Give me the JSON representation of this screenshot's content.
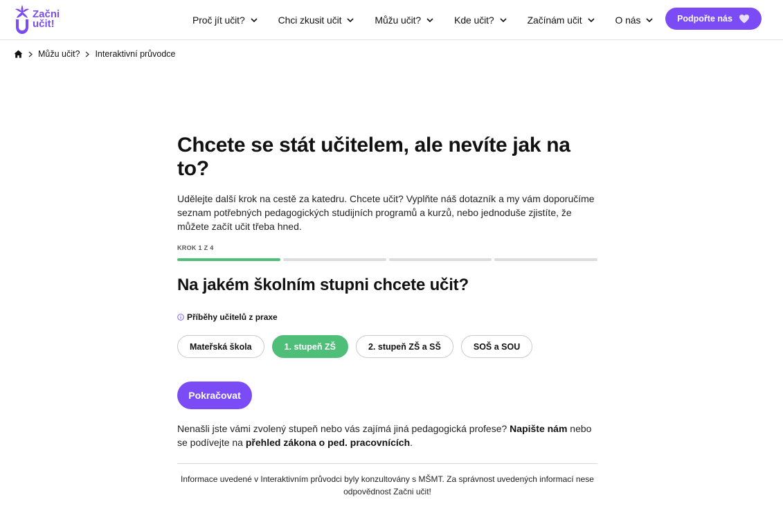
{
  "header": {
    "logo": {
      "line1": "Začni",
      "line2": "učit!",
      "color": "#7b4cf5"
    },
    "nav": [
      {
        "label": "Proč jít učit?"
      },
      {
        "label": "Chci zkusit učit"
      },
      {
        "label": "Můžu učit?"
      },
      {
        "label": "Kde učit?"
      },
      {
        "label": "Začínám učit"
      },
      {
        "label": "O nás"
      }
    ],
    "support_label": "Podpořte nás"
  },
  "breadcrumb": {
    "home_icon": "home-icon",
    "items": [
      "Můžu učit?",
      "Interaktivní průvodce"
    ]
  },
  "main": {
    "title": "Chcete se stát učitelem, ale nevíte jak na to?",
    "lead": "Udělejte další krok na cestě za katedru. Chcete učit? Vyplňte náš dotazník a my vám doporučíme seznam potřebných pedagogických studijních programů a kurzů, nebo jednoduše zjistíte, že můžete začít učit třeba hned.",
    "step_label": "KROK 1 Z 4",
    "progress": {
      "current": 1,
      "total": 4,
      "done_color": "#4fbe79",
      "todo_color": "#d9dde0"
    },
    "question": "Na jakém školním stupni chcete učit?",
    "stories_link": "Příběhy učitelů z praxe",
    "options": [
      {
        "label": "Mateřská škola",
        "selected": false
      },
      {
        "label": "1. stupeň ZŠ",
        "selected": true
      },
      {
        "label": "2. stupeň ZŠ a SŠ",
        "selected": false
      },
      {
        "label": "SOŠ a SOU",
        "selected": false
      }
    ],
    "continue_label": "Pokračovat",
    "note": {
      "part1": "Nenašli jste vámi zvolený stupeň nebo vás zajímá jiná pedagogická profese? ",
      "link1": "Napište nám",
      "part2": " nebo se podívejte na ",
      "link2": "přehled zákona o ped. pracovnících",
      "part3": "."
    },
    "disclaimer": "Informace uvedené v Interaktivním průvodci byly konzultovány s MŠMT. Za správnost uvedených informací nese odpovědnost Začni učit!"
  },
  "colors": {
    "brand": "#7b4cf5",
    "success": "#4fbe79"
  }
}
